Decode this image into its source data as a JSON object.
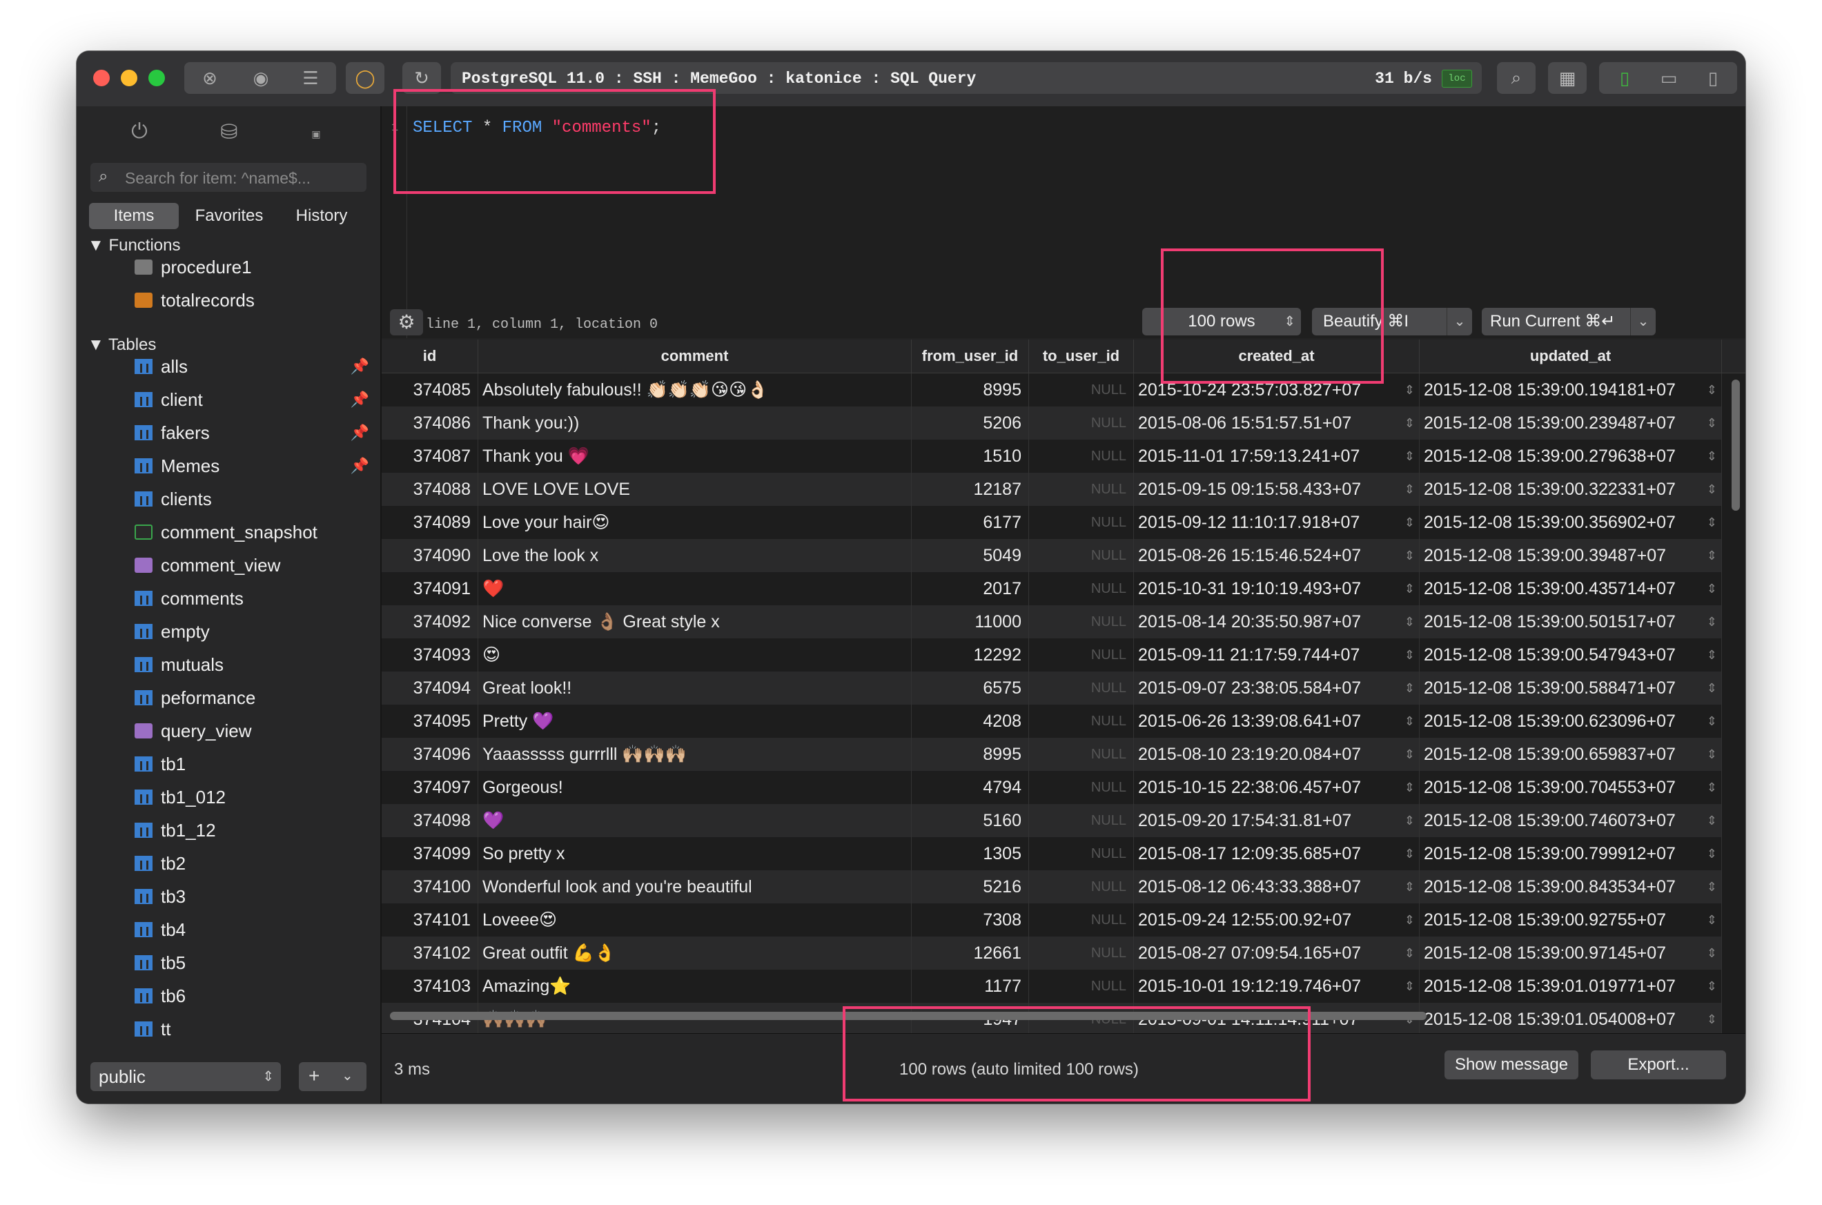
{
  "titlebar": {
    "path": "PostgreSQL 11.0 : SSH : MemeGoo : katonice : SQL Query",
    "speed": "31 b/s",
    "loc_badge": "loc"
  },
  "sidebar": {
    "search_placeholder": "Search for item: ^name$...",
    "tabs": [
      "Items",
      "Favorites",
      "History"
    ],
    "functions_header": "Functions",
    "functions": [
      "procedure1",
      "totalrecords"
    ],
    "tables_header": "Tables",
    "tables": [
      {
        "name": "alls",
        "type": "table",
        "pinned": true
      },
      {
        "name": "client",
        "type": "table",
        "pinned": true
      },
      {
        "name": "fakers",
        "type": "table",
        "pinned": true
      },
      {
        "name": "Memes",
        "type": "table",
        "pinned": true
      },
      {
        "name": "clients",
        "type": "table",
        "pinned": false
      },
      {
        "name": "comment_snapshot",
        "type": "materialized-view",
        "pinned": false
      },
      {
        "name": "comment_view",
        "type": "view",
        "pinned": false
      },
      {
        "name": "comments",
        "type": "table",
        "pinned": false
      },
      {
        "name": "empty",
        "type": "table",
        "pinned": false
      },
      {
        "name": "mutuals",
        "type": "table",
        "pinned": false
      },
      {
        "name": "peformance",
        "type": "table",
        "pinned": false
      },
      {
        "name": "query_view",
        "type": "view",
        "pinned": false
      },
      {
        "name": "tb1",
        "type": "table",
        "pinned": false
      },
      {
        "name": "tb1_012",
        "type": "table",
        "pinned": false
      },
      {
        "name": "tb1_12",
        "type": "table",
        "pinned": false
      },
      {
        "name": "tb2",
        "type": "table",
        "pinned": false
      },
      {
        "name": "tb3",
        "type": "table",
        "pinned": false
      },
      {
        "name": "tb4",
        "type": "table",
        "pinned": false
      },
      {
        "name": "tb5",
        "type": "table",
        "pinned": false
      },
      {
        "name": "tb6",
        "type": "table",
        "pinned": false
      },
      {
        "name": "tt",
        "type": "table",
        "pinned": false
      }
    ],
    "schema": "public"
  },
  "editor": {
    "line_number": "1",
    "query_kw1": "SELECT",
    "query_star": " * ",
    "query_kw2": "FROM",
    "query_table": "\"comments\"",
    "query_end": ";",
    "status": "line 1, column 1, location 0",
    "limit": "100 rows",
    "beautify": "Beautify ⌘I",
    "run": "Run Current ⌘↵"
  },
  "grid": {
    "columns": [
      "id",
      "comment",
      "from_user_id",
      "to_user_id",
      "created_at",
      "updated_at"
    ],
    "null_text": "NULL",
    "rows": [
      [
        "374085",
        "Absolutely fabulous!! 👏🏻👏🏻👏🏻😘😘👌🏻",
        "8995",
        "NULL",
        "2015-10-24 23:57:03.827+07",
        "2015-12-08 15:39:00.194181+07"
      ],
      [
        "374086",
        "Thank you:))",
        "5206",
        "NULL",
        "2015-08-06 15:51:57.51+07",
        "2015-12-08 15:39:00.239487+07"
      ],
      [
        "374087",
        "Thank you 💗",
        "1510",
        "NULL",
        "2015-11-01 17:59:13.241+07",
        "2015-12-08 15:39:00.279638+07"
      ],
      [
        "374088",
        "LOVE LOVE LOVE",
        "12187",
        "NULL",
        "2015-09-15 09:15:58.433+07",
        "2015-12-08 15:39:00.322331+07"
      ],
      [
        "374089",
        "Love your hair😍",
        "6177",
        "NULL",
        "2015-09-12 11:10:17.918+07",
        "2015-12-08 15:39:00.356902+07"
      ],
      [
        "374090",
        "Love the look x",
        "5049",
        "NULL",
        "2015-08-26 15:15:46.524+07",
        "2015-12-08 15:39:00.39487+07"
      ],
      [
        "374091",
        "❤️",
        "2017",
        "NULL",
        "2015-10-31 19:10:19.493+07",
        "2015-12-08 15:39:00.435714+07"
      ],
      [
        "374092",
        "Nice converse 👌🏽 Great style x",
        "11000",
        "NULL",
        "2015-08-14 20:35:50.987+07",
        "2015-12-08 15:39:00.501517+07"
      ],
      [
        "374093",
        "😍",
        "12292",
        "NULL",
        "2015-09-11 21:17:59.744+07",
        "2015-12-08 15:39:00.547943+07"
      ],
      [
        "374094",
        "Great look!!",
        "6575",
        "NULL",
        "2015-09-07 23:38:05.584+07",
        "2015-12-08 15:39:00.588471+07"
      ],
      [
        "374095",
        "Pretty 💜",
        "4208",
        "NULL",
        "2015-06-26 13:39:08.641+07",
        "2015-12-08 15:39:00.623096+07"
      ],
      [
        "374096",
        " Yaaasssss gurrrlll 🙌🏼🙌🏼🙌🏼",
        "8995",
        "NULL",
        "2015-08-10 23:19:20.084+07",
        "2015-12-08 15:39:00.659837+07"
      ],
      [
        "374097",
        "Gorgeous!",
        "4794",
        "NULL",
        "2015-10-15 22:38:06.457+07",
        "2015-12-08 15:39:00.704553+07"
      ],
      [
        "374098",
        "💜",
        "5160",
        "NULL",
        "2015-09-20 17:54:31.81+07",
        "2015-12-08 15:39:00.746073+07"
      ],
      [
        "374099",
        "So pretty x",
        "1305",
        "NULL",
        "2015-08-17 12:09:35.685+07",
        "2015-12-08 15:39:00.799912+07"
      ],
      [
        "374100",
        "Wonderful  look and you're beautiful",
        "5216",
        "NULL",
        "2015-08-12 06:43:33.388+07",
        "2015-12-08 15:39:00.843534+07"
      ],
      [
        "374101",
        "Loveee😍",
        "7308",
        "NULL",
        "2015-09-24 12:55:00.92+07",
        "2015-12-08 15:39:00.92755+07"
      ],
      [
        "374102",
        "Great outfit 💪👌",
        "12661",
        "NULL",
        "2015-08-27 07:09:54.165+07",
        "2015-12-08 15:39:00.97145+07"
      ],
      [
        "374103",
        "Amazing⭐",
        "1177",
        "NULL",
        "2015-10-01 19:12:19.746+07",
        "2015-12-08 15:39:01.019771+07"
      ],
      [
        "374104",
        "🙌🏽🙌🏽🙌🏽",
        "1947",
        "NULL",
        "2015-09-01 14:11:14.911+07",
        "2015-12-08 15:39:01.054008+07"
      ]
    ]
  },
  "footer": {
    "time": "3 ms",
    "rows_info": "100 rows (auto limited 100 rows)",
    "show_message": "Show message",
    "export": "Export..."
  }
}
